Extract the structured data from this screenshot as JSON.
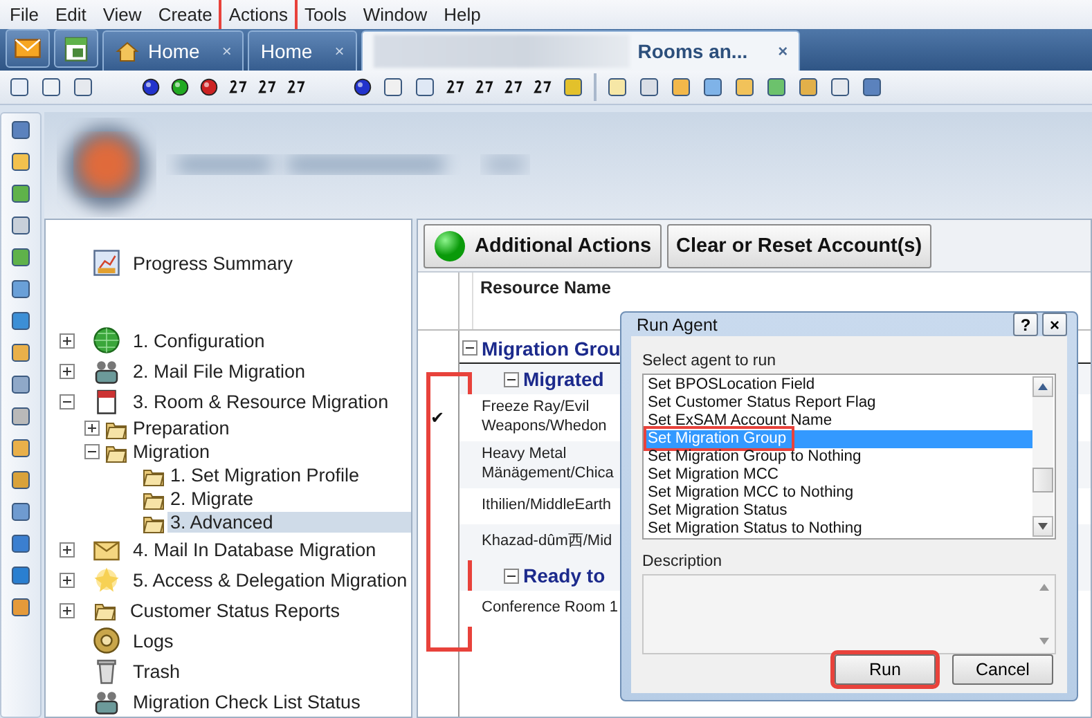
{
  "menu": [
    {
      "label": "File",
      "highlighted": false
    },
    {
      "label": "Edit",
      "highlighted": false
    },
    {
      "label": "View",
      "highlighted": false
    },
    {
      "label": "Create",
      "highlighted": false
    },
    {
      "label": "Actions",
      "highlighted": true
    },
    {
      "label": "Tools",
      "highlighted": false
    },
    {
      "label": "Window",
      "highlighted": false
    },
    {
      "label": "Help",
      "highlighted": false
    }
  ],
  "tabs": [
    {
      "kind": "mail",
      "selected": false
    },
    {
      "kind": "calendar",
      "selected": false
    },
    {
      "kind": "page",
      "label": "Home",
      "close": "×",
      "home_icon": true,
      "redacted": false,
      "selected": false
    },
    {
      "kind": "page",
      "label": "Home",
      "close": "×",
      "home_icon": false,
      "redacted": false,
      "selected": false
    },
    {
      "kind": "page",
      "label": "Rooms an...",
      "close": "×",
      "home_icon": false,
      "redacted": true,
      "selected": true
    }
  ],
  "tree": [
    {
      "kind": "leaf",
      "label": "Progress Summary",
      "selected": false
    },
    {
      "kind": "node",
      "label": "1. Configuration",
      "expanded": false,
      "selected": false
    },
    {
      "kind": "node",
      "label": "2. Mail File Migration",
      "expanded": false,
      "selected": false
    },
    {
      "kind": "node",
      "label": "3. Room & Resource Migration",
      "expanded": true,
      "selected": false,
      "children": [
        {
          "kind": "node",
          "label": "Preparation",
          "expanded": false,
          "selected": false
        },
        {
          "kind": "node",
          "label": "Migration",
          "expanded": true,
          "selected": false,
          "children": [
            {
              "kind": "leaf",
              "label": "1. Set Migration Profile",
              "selected": false
            },
            {
              "kind": "leaf",
              "label": "2. Migrate",
              "selected": false
            },
            {
              "kind": "leaf",
              "label": "3. Advanced",
              "selected": true
            }
          ]
        }
      ]
    },
    {
      "kind": "node",
      "label": "4. Mail In Database Migration",
      "expanded": false,
      "selected": false
    },
    {
      "kind": "node",
      "label": "5. Access & Delegation Migration",
      "expanded": false,
      "selected": false
    },
    {
      "kind": "node",
      "label": "Customer Status Reports",
      "expanded": false,
      "selected": false
    },
    {
      "kind": "leaf",
      "label": "Logs",
      "selected": false
    },
    {
      "kind": "leaf",
      "label": "Trash",
      "selected": false
    },
    {
      "kind": "leaf",
      "label": "Migration Check List Status",
      "selected": false
    }
  ],
  "action_buttons": [
    {
      "label": "Additional Actions",
      "status_icon": true
    },
    {
      "label": "Clear or Reset Account(s)",
      "status_icon": false
    }
  ],
  "grid": {
    "check_column_highlighted": true,
    "check_glyph": "✔",
    "columns": [
      "Resource Name"
    ],
    "groups": [
      {
        "label": "Migration Grou",
        "expanded": true,
        "subgroups": [
          {
            "label": "Migrated",
            "expanded": true,
            "rows": [
              {
                "name": "Freeze Ray/Evil Weapons/Whedon",
                "checked": true
              },
              {
                "name": "Heavy Metal Mänägement/Chica",
                "checked": false
              },
              {
                "name": "Ithilien/MiddleEarth",
                "checked": false
              },
              {
                "name": "Khazad-dûm西/Mid",
                "checked": false
              }
            ]
          },
          {
            "label": "Ready to",
            "expanded": true,
            "rows": [
              {
                "name": "Conference Room 1",
                "checked": false
              }
            ]
          }
        ]
      }
    ]
  },
  "dialog": {
    "title": "Run Agent",
    "help": "?",
    "close": "×",
    "list_label": "Select agent to run",
    "agents": [
      {
        "label": "Set BPOSLocation Field",
        "selected": false,
        "highlighted": false
      },
      {
        "label": "Set Customer Status Report Flag",
        "selected": false,
        "highlighted": false
      },
      {
        "label": "Set ExSAM Account Name",
        "selected": false,
        "highlighted": false
      },
      {
        "label": "Set Migration Group",
        "selected": true,
        "highlighted": true
      },
      {
        "label": "Set Migration Group to Nothing",
        "selected": false,
        "highlighted": false
      },
      {
        "label": "Set Migration MCC",
        "selected": false,
        "highlighted": false
      },
      {
        "label": "Set Migration MCC to Nothing",
        "selected": false,
        "highlighted": false
      },
      {
        "label": "Set Migration Status",
        "selected": false,
        "highlighted": false
      },
      {
        "label": "Set Migration Status to Nothing",
        "selected": false,
        "highlighted": false
      }
    ],
    "description_label": "Description",
    "buttons": [
      {
        "label": "Run",
        "highlighted": true
      },
      {
        "label": "Cancel",
        "highlighted": false
      }
    ]
  }
}
